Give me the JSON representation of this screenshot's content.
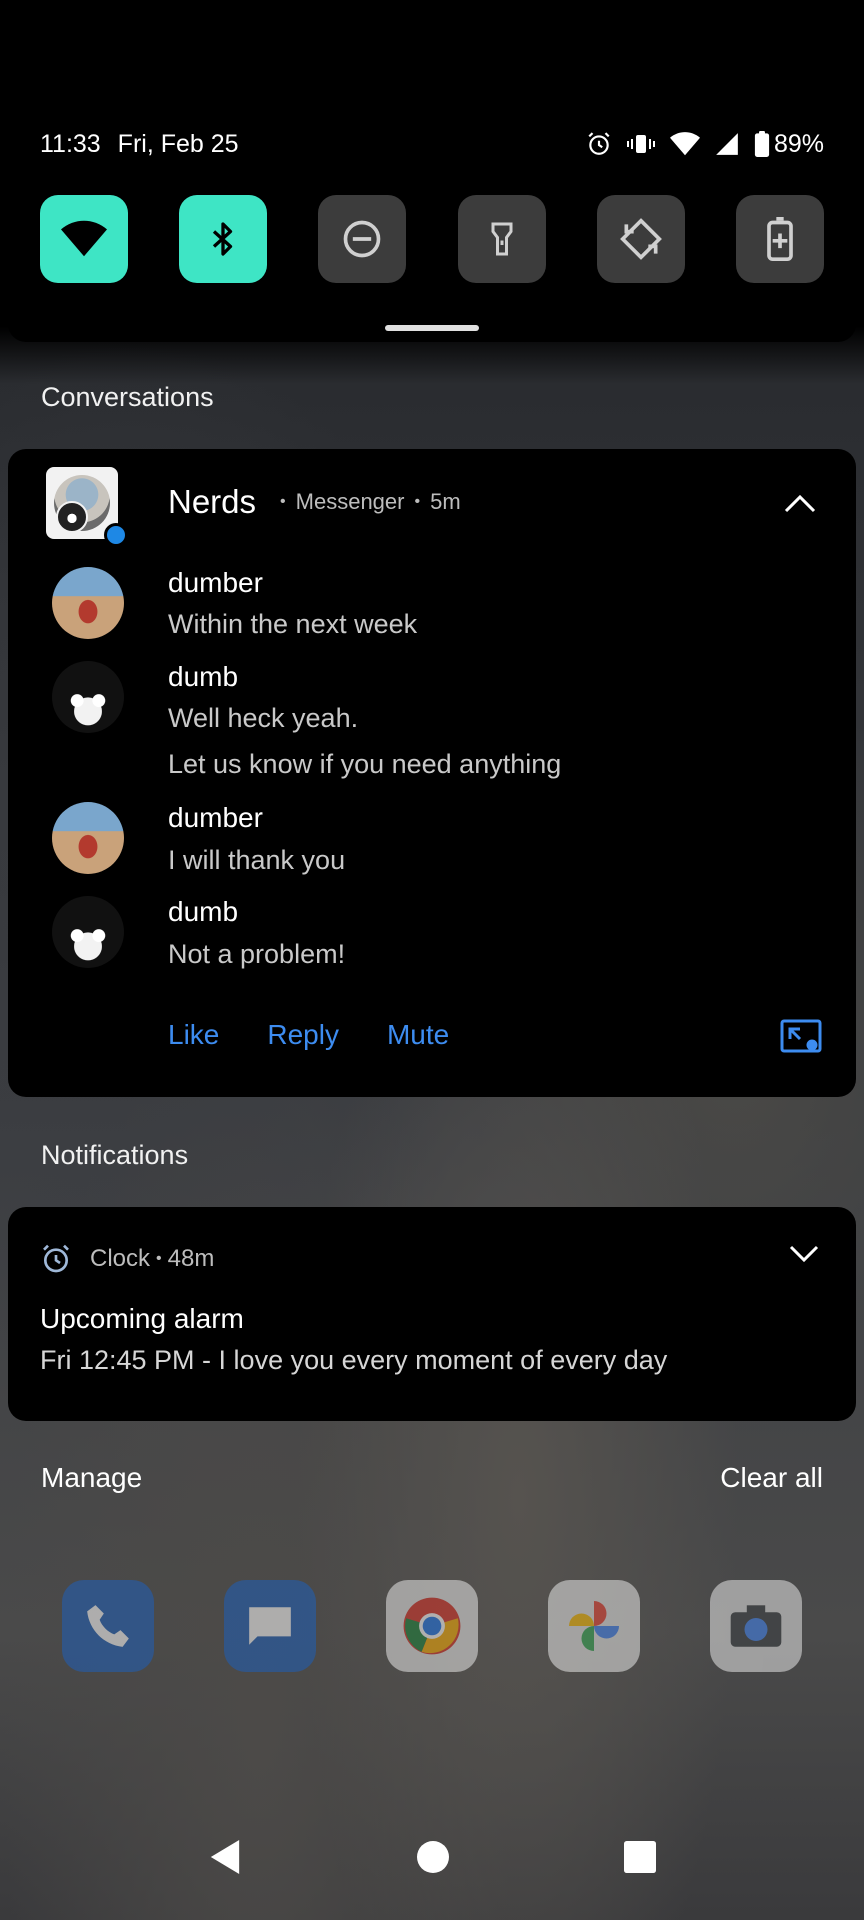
{
  "status_bar": {
    "time": "11:33",
    "date": "Fri, Feb 25",
    "battery": "89%"
  },
  "quick_settings": {
    "tiles": [
      {
        "icon": "wifi-icon",
        "on": true
      },
      {
        "icon": "bluetooth-icon",
        "on": true
      },
      {
        "icon": "do-not-disturb-icon",
        "on": false
      },
      {
        "icon": "flashlight-icon",
        "on": false
      },
      {
        "icon": "auto-rotate-icon",
        "on": false
      },
      {
        "icon": "battery-saver-icon",
        "on": false
      }
    ]
  },
  "conversations": {
    "section_label": "Conversations",
    "card": {
      "title": "Nerds",
      "app": "Messenger",
      "time": "5m",
      "messages": [
        {
          "sender": "dumber",
          "lines": [
            "Within the next week"
          ]
        },
        {
          "sender": "dumb",
          "lines": [
            "Well heck yeah.",
            "Let us know if you need anything"
          ]
        },
        {
          "sender": "dumber",
          "lines": [
            "I will thank you"
          ]
        },
        {
          "sender": "dumb",
          "lines": [
            "Not a problem!"
          ]
        }
      ],
      "actions": {
        "like": "Like",
        "reply": "Reply",
        "mute": "Mute"
      }
    }
  },
  "notifications": {
    "section_label": "Notifications",
    "clock": {
      "app": "Clock",
      "time": "48m",
      "title": "Upcoming alarm",
      "text": "Fri 12:45 PM - I love you every moment of every day"
    }
  },
  "footer": {
    "manage": "Manage",
    "clear_all": "Clear all"
  },
  "colors": {
    "accent_tile": "#3ee5c5",
    "action_blue": "#3d8cf0"
  }
}
